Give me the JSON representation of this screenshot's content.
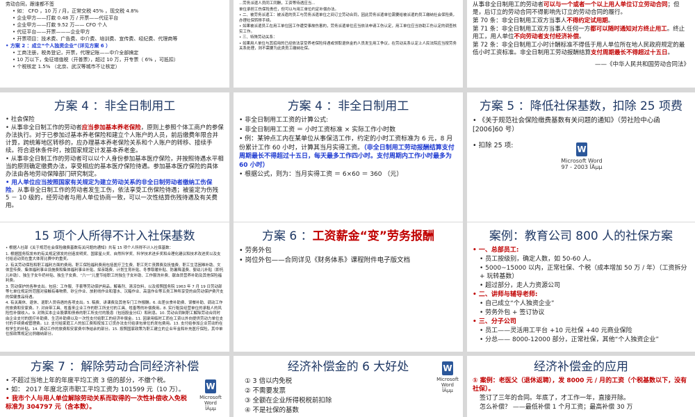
{
  "s1": {
    "lines": [
      "劳动合同，跟谁都不签",
      "• 如： CFO ，10 万 / 月，正常交税 45% ，现交税 4.8%",
      "• 企业甲方——打款 0.48 万 / 开票——代征平台",
      "• 企业甲方——打款 9.52 万—— CFO 个人",
      "• 代征平台——开票———企业甲方",
      "• 开票项目：技术费、广告费、中介费、培训费、宣传费、经纪费、代理商等",
      "• 方案 2 ：成立“个人独资企业”（详见方案 6 ）",
      "• 工商注册，税务登记，开票，代理记账——中介全部搞定",
      "• 10 万以下，免征增值税（开普票），超过 10 万，开专票（ 6% ，可抵扣）",
      "• 个税核定 1.5% （北京、武汉等城市不让核定）"
    ]
  },
  "s2": {
    "lines": [
      "...劳务派遣人员同工同酬，工资等待遇应当...",
      "单位承担工伤保险责任，但可以与用工单位约定补偿办法。",
      "• 二、被劳务派遣工：被派遣的员工与劳务派遣单位之间订立劳动合同，因此劳务派遣单位需要给被派遣的员工缴纳社会保险费，办理社保转移手续。",
      "• 如果被派遣员工在用工单位因工作遭受事故伤害的，劳务派遣单位应当依法申请工伤认定，用工单位应当协助工伤认定的调查核实工作。",
      "• 三、特殊劳动关系：",
      "• 如果用人单位与其招用的已经依法享受养老保险待遇或领取退休金的人员发生用工争议，在劳动关系认定上人民法院应当按劳务关系处理，则不需要为此类员工缴纳社保。"
    ]
  },
  "s3": {
    "line1": "从事非全日制用工的劳动者",
    "line1_red": "可以与一个或者一个以上用人单位订立劳动合同",
    "line1_end": "；但是，后订立的劳动合同不得影响先订立的劳动合同的履行。",
    "a70": "第 70 条：非全日制用工双方当事人",
    "a70_red": "不得约定试用期",
    "a70_end": "。",
    "a71": "第 71 条：非全日制用工双方当事人任何一方",
    "a71_red": "都可以随时通知对方终止用工",
    "a71_mid": "。终止用工，用人单位",
    "a71_red2": "不向劳动者支付经济补偿",
    "a71_end": "。",
    "a72": "第 72 条：非全日制用工小时计酬标准不得低于用人单位所在地人民政府规定的最低小时工资标准。非全日制用工劳动报酬结算",
    "a72_red": "支付周期最长不得超过十五日",
    "a72_end": "。",
    "source": "——《中华人民共和国劳动合同法》"
  },
  "s4": {
    "title": "方案 4 ：非全日制用工",
    "p1": "• 社会保险",
    "p2a": "• 从事非全日制工作的劳动者",
    "p2red": "应当参加基本养老保险",
    "p2b": "，原则上参照个体工商户的参保办法执行。对于已参加过基本养老保险和建立个人账户的人员，前后缴费年限合并计算，跨统筹地区转移的，应办理基本养老保险关系和个人账户的转移、接续手续。符合退休条件时，按国家规定计发基本养老金。",
    "p3": "• 从事非全日制工作的劳动者可以以个人身份参加基本医疗保险，并按照待遇水平相当的原则确定缴费办法，享受相应的基本医疗保险待遇。参加基本医疗保险的具体办法由各地劳动保障部门研究制定。",
    "p4blue": "• 用人单位应当按照国家有关规定为建立劳动关系的非全日制劳动者缴纳工伤保险",
    "p4b": "。从事非全日制工作的劳动者发生工伤，依法享受工伤保险待遇；被鉴定为伤残 5 － 10 级的，经劳动者与用人单位协商一致，可以一次性结算伤残待遇及有关费用。"
  },
  "s5": {
    "title": "方案 4 ：非全日制用工",
    "l1": "• 非全日制用工工资的计算公式:",
    "l2": "• 非全日制用工工资 ＝ 小时工资标准 × 实际工作小时数",
    "l3a": "• 例：某钟点工内在某单位从事保洁工作，约定的小时工资标准为 6 元，8 月份累计工作 60 小时，计算其当月实得工资。",
    "l3blue": "（非全日制用工劳动报酬结算支付周期最长不得超过十五日，每天最多工作四小时。支付周期内工作小时最多为 60 小时）",
    "l4": "• 根据公式，则为：当月实得工资 ＝ 6×60 ＝ 360 （元）"
  },
  "s6": {
    "title": "方案 5 ：降低社保基数，扣除 25 项费",
    "l1": "• 《关于规范社会保险缴费基数有关问题的通知》（劳社险中心函 [2006]60 号）",
    "l2": "• 扣除 25 项:",
    "word_label": "Microsoft Word",
    "word_sub": "97 - 2003 ÎÄµµ"
  },
  "s7": {
    "title": "15 项个人所得不计入社保基数",
    "intro": "• 根据人社部《关于规范社会保险缴费基数有关问题的通知》共有 15 项个人所得不计入社保基数：",
    "items": [
      "1. 根据国务院发布的有关规定颁发的创造发明奖、国家星火奖、自然科学奖、科学技术进步奖和合理化建议和技术改进奖以及支付给运动员在重大体育比赛中的重奖。",
      "2. 有关劳动保险和职工福利方面的费用。职工保险福利费用包括医疗卫生费、职工死亡丧葬费及抚恤费、职工生活困难补助、文体宣传费、集体福利事业设施费和集体福利事业补贴、探亲路费、计划生育补贴、冬季取暖补贴、防暑降温费、婴幼儿补贴（即托儿补助）、独生子女牛奶补贴、独生子女费、“六一”儿童节给职工的独生子女补助、工作服洗补费、献血员营养补助及其他保险福利费。",
      "3. 劳动保护的各种支出。包括：工作服、手套等劳动保护用品，解毒剂、清凉饮料，以及按照国务院 1963 年 7 月 19 日劳动部等七单位规定的范围对接触有毒物质、矽尘作业、放射线作业和潜水、沉箱作业、高温作业等五类工种所享受的由劳动保护费开支的保健食品待遇。",
      "4. 有关离休、退休、退职人员待遇的各项支出。5. 稿费、讲课费及其他专门工作报酬。6. 出差伙食补助费、误餐补助、调动工作的旅费和安家费。7. 对自带工具、牲畜来企业工作的职工所支付的工具、牲畜等的补偿费用。8. 实行租赁经营单位的承租人的风险性补偿收入。9. 对购买本企业股票和债券的职工所支付的股息（包括股金分红）和利息。10. 劳动合同制职工解除劳动合同时由企业支付的医疗补助费、生活补助费以及一次性支付给职工的经济补偿金。11. 因录用临时工而在工资以外向提供劳动力单位支付的手续费或管理费。12. 支付给家庭工人的加工费和按加工订货办法支付给承包单位的发包费用。13. 支付给参加企业劳动的在校学生的补贴。14. 调动工作的旅费和安家费中净结余的部分。15. 按照国家政策为职工建立的企业年金和补充医疗保险，其中单位按政策规定比例缴纳部分。"
    ]
  },
  "s8": {
    "title": "方案 6 ：",
    "title_red": "工资薪金“变”劳务报酬",
    "l1": "• 劳务外包",
    "l2": "• 岗位外包——合同详见《财务体系》课程附件电子版文档"
  },
  "s9": {
    "title": "案例：教育公司 800 人的社保方案",
    "h1": "• 一、总部员工:",
    "h1_items": [
      "• 员工按级别，确定人数，如 50-60 人。",
      "• 5000~15000 以内，正常社保、个税（成本增加 50 万 / 年）（工资拆分 + 玩转基数）",
      "• 超过部分，走人力资源公司"
    ],
    "h2": "• 二、讲师与辅导老师:",
    "h2_items": [
      "• 自己成立“个人独资企业”",
      "• 劳务外包 + 签订协议"
    ],
    "h3": "• 三、分子公司",
    "h3_items": [
      "• 员工——灵活用工平台 +10 元社保 +40 元商业保险",
      "• 分总—— 8000-12000 部分，正常社保，其他“个人独资企业”"
    ]
  },
  "s10": {
    "title": "方案 7 ：解除劳动合同经济补偿",
    "l1": "• 不超过当地上年的年度平均工资 3 倍的部分，不缴个税。",
    "l2": "• 如： 2017 年度北京市职工平均工资为 101599 元（10 万）。",
    "l3red": "• 我市个人与用人单位解除劳动关系而取得的一次性补偿收入免税标准为 304797 元（含本数）。",
    "word_label": "Microsoft Word",
    "word_sub": "ÎÄµµ"
  },
  "s11": {
    "title": "经济补偿金的 6 大好处",
    "items": [
      "① 3 倍以内免税",
      "② 不需要发票",
      "③ 全额在企业所得税税前扣除",
      "④ 不是社保的基数"
    ],
    "word_label": "Microsoft Word",
    "word_sub": "ÎÄµµ"
  },
  "s12": {
    "title": "经济补偿金的应用",
    "l1red": "① 案例：老医父（退休返聘），发 8000 元 / 月的工资（个税基数以下，没有社保）。",
    "l2": "签订了三年的合同。年底了，才工作一年，直接开除。",
    "l3": "怎么补偿？ ——最低补偿 1 个月工资；最高补偿 30 万"
  }
}
